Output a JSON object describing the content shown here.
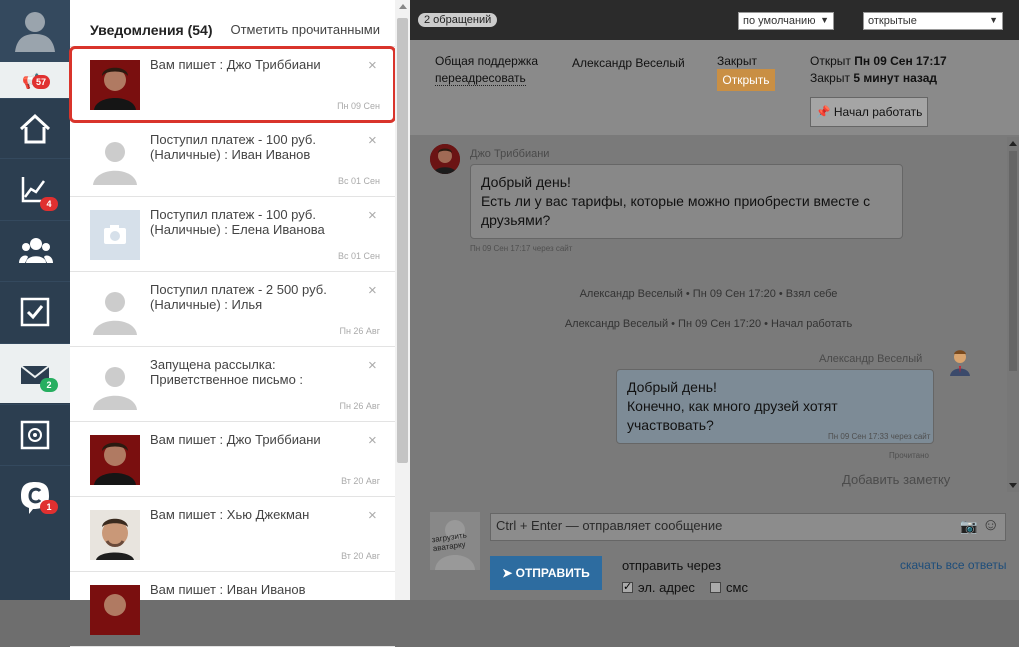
{
  "sidebar": {
    "notifications_badge": "57",
    "items": [
      {
        "icon": "home-icon",
        "badge": ""
      },
      {
        "icon": "chart-icon",
        "badge": "4"
      },
      {
        "icon": "users-icon",
        "badge": ""
      },
      {
        "icon": "checkbox-icon",
        "badge": ""
      },
      {
        "icon": "mail-icon",
        "badge": "2"
      },
      {
        "icon": "safe-icon",
        "badge": ""
      },
      {
        "icon": "chat-bubble-icon",
        "badge": "1"
      }
    ]
  },
  "notifications": {
    "title": "Уведомления (54)",
    "mark_read": "Отметить прочитанными",
    "items": [
      {
        "text": "Вам пишет : Джо Триббиани",
        "date": "Пн 09 Сен",
        "avatar": "photo-joey"
      },
      {
        "text": "Поступил платеж - 100 руб. (Наличные) : Иван Иванов",
        "date": "Вс 01 Сен",
        "avatar": "silhouette"
      },
      {
        "text": "Поступил платеж - 100 руб. (Наличные) : Елена Иванова",
        "date": "Вс 01 Сен",
        "avatar": "camera"
      },
      {
        "text": "Поступил платеж - 2 500 руб. (Наличные) : Илья",
        "date": "Пн 26 Авг",
        "avatar": "silhouette"
      },
      {
        "text": "Запущена рассылка: Приветственное письмо :",
        "date": "Пн 26 Авг",
        "avatar": "silhouette"
      },
      {
        "text": "Вам пишет : Джо Триббиани",
        "date": "Вт 20 Авг",
        "avatar": "photo-joey"
      },
      {
        "text": "Вам пишет : Хью Джекман",
        "date": "Вт 20 Авг",
        "avatar": "photo-hugh"
      },
      {
        "text": "Вам пишет : Иван Иванов",
        "date": "",
        "avatar": "photo-joey"
      }
    ]
  },
  "topbar": {
    "count": "2 обращений",
    "sort": "по умолчанию",
    "filter": "открытые"
  },
  "ticket": {
    "group": "Общая поддержка",
    "reassign": "переадресовать",
    "agent": "Александр Веселый",
    "status": "Закрыт",
    "open_button": "Открыть",
    "opened_label": "Открыт",
    "opened_value": "Пн 09 Сен 17:17",
    "closed_label": "Закрыт",
    "closed_value": "5 минут назад",
    "start_button": "Начал работать"
  },
  "chat": {
    "msg1_name": "Джо Триббиани",
    "msg1_text": "Добрый день!\nЕсть ли у вас тарифы, которые можно приобрести вместе с друзьями?",
    "msg1_meta": "Пн 09 Сен 17:17 через сайт",
    "sys1": "Александр Веселый • Пн 09 Сен 17:20 • Взял себе",
    "sys2": "Александр Веселый • Пн 09 Сен 17:20 • Начал работать",
    "msg2_name": "Александр Веселый",
    "msg2_text": "Добрый день!\nКонечно, как много друзей хотят участвовать?",
    "msg2_meta": "Пн 09 Сен 17:33 через сайт",
    "msg2_status": "Прочитано",
    "add_note": "Добавить заметку"
  },
  "compose": {
    "upload_avatar": "загрузить аватарку",
    "placeholder": "Ctrl + Enter — отправляет сообщение",
    "send": "ОТПРАВИТЬ",
    "send_via": "отправить через",
    "download_all": "скачать все ответы",
    "email": "эл. адрес",
    "sms": "смс"
  },
  "colors": {
    "sidebar": "#2c3e50",
    "badge": "#e03030",
    "accent": "#2d6ca0",
    "open_button": "#c98f44",
    "highlight": "#d9342b"
  }
}
